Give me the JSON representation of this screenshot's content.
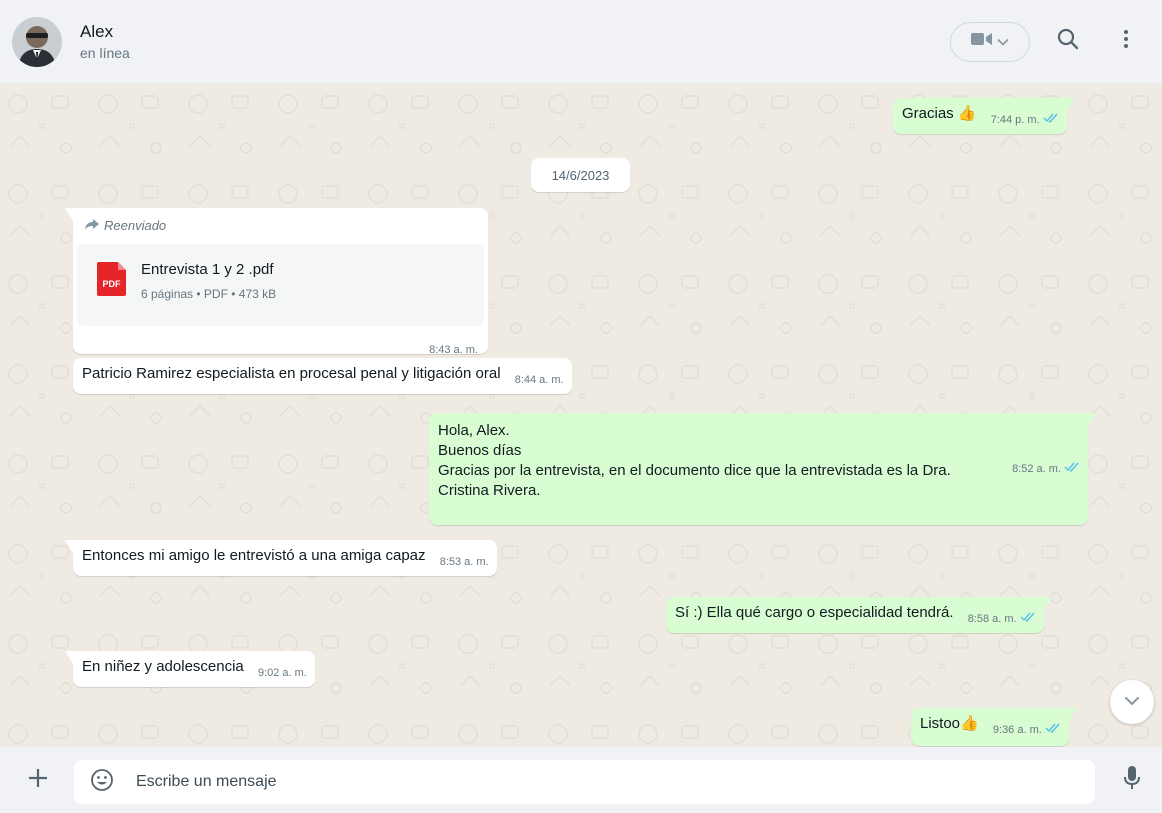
{
  "header": {
    "name": "Alex",
    "status": "en línea",
    "icons": [
      "video-call-icon",
      "chevron-down-icon",
      "search-icon",
      "menu-dots-icon"
    ]
  },
  "date_separator": "14/6/2023",
  "messages": [
    {
      "direction": "outgoing",
      "text": "Gracias",
      "emoji": "👍",
      "time": "7:44 p. m.",
      "status": "read"
    },
    {
      "direction": "incoming",
      "forwarded_label": "Reenviado",
      "document": {
        "name": "Entrevista 1 y 2 .pdf",
        "details": "6 páginas • PDF • 473 kB",
        "icon_label": "PDF"
      },
      "time": "8:43 a. m."
    },
    {
      "direction": "incoming",
      "text": "Patricio Ramirez especialista en procesal penal y litigación oral",
      "time": "8:44 a. m."
    },
    {
      "direction": "outgoing",
      "text": "Hola, Alex.\nBuenos días\nGracias por la entrevista, en el documento dice que la entrevistada es la Dra.\nCristina Rivera.",
      "time": "8:52 a. m.",
      "status": "read"
    },
    {
      "direction": "incoming",
      "text": "Entonces mi amigo le entrevistó a una amiga capaz",
      "time": "8:53 a. m."
    },
    {
      "direction": "outgoing",
      "text": "Sí :) Ella qué cargo o especialidad tendrá.",
      "time": "8:58 a. m.",
      "status": "read"
    },
    {
      "direction": "incoming",
      "text": "En niñez y adolescencia",
      "time": "9:02 a. m."
    },
    {
      "direction": "outgoing",
      "text": "Listoo",
      "emoji": "👍",
      "time": "9:36 a. m.",
      "status": "read"
    }
  ],
  "composer": {
    "placeholder": "Escribe un mensaje",
    "icons": [
      "plus-icon",
      "emoji-icon",
      "microphone-icon"
    ]
  },
  "colors": {
    "header_bg": "#f0f2f5",
    "chat_bg": "#efeae2",
    "incoming_bubble": "#ffffff",
    "outgoing_bubble": "#d9fdd3",
    "read_ticks": "#53bdeb",
    "pdf_red": "#e5252a"
  }
}
